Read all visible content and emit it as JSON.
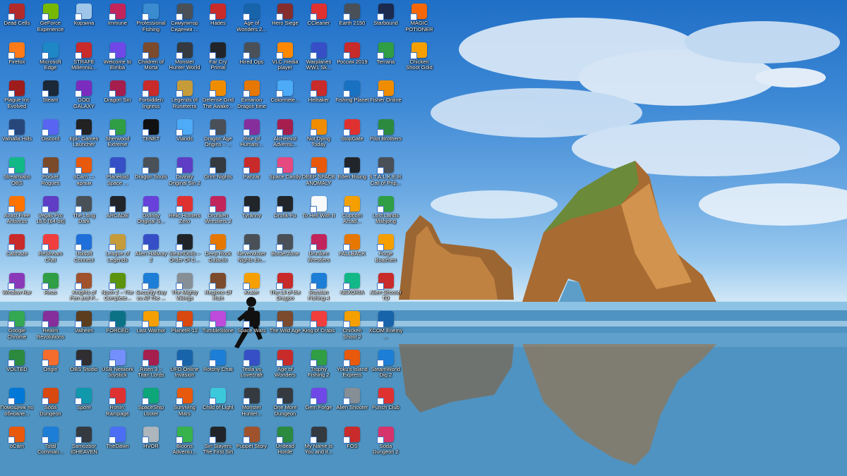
{
  "desktop": {
    "colors": {
      "sky_top": "#1f6fc7",
      "sky_mid": "#6aa8e2",
      "horizon": "#cfe6f6",
      "sea": "#3f84b4",
      "rock": "#b57a3c",
      "grass": "#6b8a3a"
    },
    "columns": [
      [
        {
          "label": "Dead Cells",
          "icon": "dead-cells-icon",
          "color": "#b32a2a"
        },
        {
          "label": "Firefox",
          "icon": "firefox-icon",
          "color": "#ff7a18"
        },
        {
          "label": "Plague Inc Evolved",
          "icon": "plague-inc-icon",
          "color": "#9e1c1c"
        },
        {
          "label": "Valhalla Hills",
          "icon": "valhalla-hills-icon",
          "color": "#27477a"
        },
        {
          "label": "Streamlabs OBS",
          "icon": "streamlabs-icon",
          "color": "#12b886"
        },
        {
          "label": "Avast Free Antivirus",
          "icon": "avast-icon",
          "color": "#ff7300"
        },
        {
          "label": "Catmaze",
          "icon": "catmaze-icon",
          "color": "#c92a2a"
        },
        {
          "label": "Window Rar",
          "icon": "winrar-icon",
          "color": "#8a3ab9"
        },
        {
          "label": "Google Chrome",
          "icon": "chrome-icon",
          "color": "#34a853"
        },
        {
          "label": "VOLTED",
          "icon": "volted-icon",
          "color": "#2b8a3e"
        },
        {
          "label": "Помощник по обновле...",
          "icon": "windows-update-icon",
          "color": "#0078d7"
        },
        {
          "label": "oCam",
          "icon": "ocam-icon",
          "color": "#e8590c"
        }
      ],
      [
        {
          "label": "GeForce Experience",
          "icon": "geforce-icon",
          "color": "#76b900"
        },
        {
          "label": "Microsoft Edge",
          "icon": "edge-icon",
          "color": "#1e88c7"
        },
        {
          "label": "Steam",
          "icon": "steam-icon",
          "color": "#1b2838"
        },
        {
          "label": "Discord",
          "icon": "discord-icon",
          "color": "#5865f2"
        },
        {
          "label": "Pocket Rogues",
          "icon": "pocket-rogues-icon",
          "color": "#7a4a2a"
        },
        {
          "label": "Vegas Pro 18.0 (64-bit)",
          "icon": "vegas-pro-icon",
          "color": "#5f3dc4"
        },
        {
          "label": "ReStream Chat",
          "icon": "restream-icon",
          "color": "#f03e3e"
        },
        {
          "label": "Reus",
          "icon": "reus-icon",
          "color": "#2f9e44"
        },
        {
          "label": "Realm Revolutions",
          "icon": "realm-revolutions-icon",
          "color": "#862e9c"
        },
        {
          "label": "Origin",
          "icon": "origin-icon",
          "color": "#f56c2d"
        },
        {
          "label": "Soda Dungeon",
          "icon": "soda-dungeon-icon",
          "color": "#d9480f"
        },
        {
          "label": "Total Comman...",
          "icon": "total-commander-icon",
          "color": "#1c7ed6"
        }
      ],
      [
        {
          "label": "Корзина",
          "icon": "recycle-bin-icon",
          "color": "#9fc5e8"
        },
        {
          "label": "STRAFE Millenniu...",
          "icon": "strafe-icon",
          "color": "#c92a2a"
        },
        {
          "label": "GOG GALAXY",
          "icon": "gog-galaxy-icon",
          "color": "#7b2cbf"
        },
        {
          "label": "Epic Games Launcher",
          "icon": "epic-games-icon",
          "color": "#222222"
        },
        {
          "label": "oCam — ярлык",
          "icon": "ocam-shortcut-icon",
          "color": "#e8590c"
        },
        {
          "label": "The Long Dark",
          "icon": "the-long-dark-icon",
          "color": "#495057"
        },
        {
          "label": "Ubisoft Connect",
          "icon": "ubisoft-icon",
          "color": "#1e6fd9"
        },
        {
          "label": "Knights of Pen and P...",
          "icon": "knights-pen-paper-icon",
          "color": "#a0522d"
        },
        {
          "label": "Valheim",
          "icon": "valheim-icon",
          "color": "#5c3d1e"
        },
        {
          "label": "OBS Studio",
          "icon": "obs-studio-icon",
          "color": "#302e31"
        },
        {
          "label": "Spore",
          "icon": "spore-icon",
          "color": "#1098ad"
        },
        {
          "label": "Samozbor IDHEAVEN",
          "icon": "samozbor-icon",
          "color": "#343a40"
        }
      ],
      [
        {
          "label": "Immune",
          "icon": "immune-icon",
          "color": "#c2255c"
        },
        {
          "label": "Welcome to Elmba",
          "icon": "welcome-elmba-icon",
          "color": "#7048e8"
        },
        {
          "label": "Dragon Sin",
          "icon": "dragon-sin-icon",
          "color": "#a61e4d"
        },
        {
          "label": "Sherwood Extreme",
          "icon": "sherwood-extreme-icon",
          "color": "#2f9e44"
        },
        {
          "label": "Planetoid Space ...",
          "icon": "planetoid-icon",
          "color": "#364fc7"
        },
        {
          "label": "ARCADE",
          "icon": "arcade-icon",
          "color": "#212529"
        },
        {
          "label": "League of Legends",
          "icon": "league-of-legends-icon",
          "color": "#c69b3a"
        },
        {
          "label": "Noch 2 – The Complete...",
          "icon": "noch-icon",
          "color": "#5c940d"
        },
        {
          "label": "FORCED",
          "icon": "forced-icon",
          "color": "#0b7285"
        },
        {
          "label": "USB Network Joystick",
          "icon": "usb-joystick-icon",
          "color": "#748ffc"
        },
        {
          "label": "Ronin: Rampage",
          "icon": "ronin-rampage-icon",
          "color": "#e03131"
        },
        {
          "label": "TheDawn",
          "icon": "thedawn-icon",
          "color": "#4c6ef5"
        }
      ],
      [
        {
          "label": "Professional Fishing",
          "icon": "professional-fishing-icon",
          "color": "#3b8bd0"
        },
        {
          "label": "Children of Morta",
          "icon": "children-of-morta-icon",
          "color": "#7c4a2d"
        },
        {
          "label": "Forbidden Ingress",
          "icon": "forbidden-ingress-icon",
          "color": "#c92a2a"
        },
        {
          "label": "TENET",
          "icon": "tenet-icon",
          "color": "#111111"
        },
        {
          "label": "Dragon Souls",
          "icon": "dragon-souls-icon",
          "color": "#495057"
        },
        {
          "label": "Divinity Original S...",
          "icon": "divinity-icon",
          "color": "#6741d9"
        },
        {
          "label": "Alien Hallway 2",
          "icon": "alien-hallway-icon",
          "color": "#364fc7"
        },
        {
          "label": "Security Guy vs All The ...",
          "icon": "security-guy-icon",
          "color": "#1c7ed6"
        },
        {
          "label": "Last Warrior",
          "icon": "last-warrior-icon",
          "color": "#f59f00"
        },
        {
          "label": "Risen 3 – Titan Lords",
          "icon": "risen-3-icon",
          "color": "#a61e4d"
        },
        {
          "label": "SpaceShip Looter",
          "icon": "spaceship-looter-icon",
          "color": "#0ca678"
        },
        {
          "label": "HVOR",
          "icon": "hvor-icon",
          "color": "#adb5bd"
        }
      ],
      [
        {
          "label": "Симулятор Сидения ...",
          "icon": "sitting-simulator-icon",
          "color": "#495057"
        },
        {
          "label": "Monster Hunter World",
          "icon": "monster-hunter-world-icon",
          "color": "#343a40"
        },
        {
          "label": "Legends of Runeterra",
          "icon": "legends-runeterra-icon",
          "color": "#c69b3a"
        },
        {
          "label": "Vlands",
          "icon": "vlands-icon",
          "color": "#4dabf7"
        },
        {
          "label": "Divinity Original Sin 2",
          "icon": "divinity-2-icon",
          "color": "#5f3dc4"
        },
        {
          "label": "Relic Hunters Zero",
          "icon": "relic-hunters-icon",
          "color": "#e03131"
        },
        {
          "label": "SteamDolls – Order Of C...",
          "icon": "steamdolls-icon",
          "color": "#212529"
        },
        {
          "label": "The Mighty Vikings",
          "icon": "mighty-vikings-icon",
          "color": "#868e96"
        },
        {
          "label": "PlanetR-12",
          "icon": "planetr12-icon",
          "color": "#d9480f"
        },
        {
          "label": "UFO Online Invasion",
          "icon": "ufo-online-icon",
          "color": "#1864ab"
        },
        {
          "label": "Surviving Mars",
          "icon": "surviving-mars-icon",
          "color": "#e8590c"
        },
        {
          "label": "Bloons Adventu...",
          "icon": "bloons-icon",
          "color": "#37b24d"
        }
      ],
      [
        {
          "label": "Hades",
          "icon": "hades-icon",
          "color": "#c92a2a"
        },
        {
          "label": "Far Cry Primal",
          "icon": "far-cry-primal-icon",
          "color": "#212529"
        },
        {
          "label": "Defense Grid The Awake...",
          "icon": "defense-grid-icon",
          "color": "#f08c00"
        },
        {
          "label": "Dragon Age Origins – ...",
          "icon": "dragon-age-icon",
          "color": "#495057"
        },
        {
          "label": "Grim Nights",
          "icon": "grim-nights-icon",
          "color": "#343a40"
        },
        {
          "label": "Drunken Wrestlers 2",
          "icon": "drunken-wrestlers-2-icon",
          "color": "#c2255c"
        },
        {
          "label": "Deep Rock Galactic",
          "icon": "deep-rock-icon",
          "color": "#e67700"
        },
        {
          "label": "Regions Of Ruin",
          "icon": "regions-of-ruin-icon",
          "color": "#7c4a2d"
        },
        {
          "label": "TumbleStone",
          "icon": "tumblestone-icon",
          "color": "#be4bdb"
        },
        {
          "label": "Rotony Chat",
          "icon": "rotony-chat-icon",
          "color": "#1c7ed6"
        },
        {
          "label": "Child of Light",
          "icon": "child-of-light-icon",
          "color": "#3bc9db"
        },
        {
          "label": "Sin Slayers The First Sin",
          "icon": "sin-slayers-icon",
          "color": "#212529"
        }
      ],
      [
        {
          "label": "Age of Wonders 2...",
          "icon": "age-of-wonders-2-icon",
          "color": "#1864ab"
        },
        {
          "label": "Hired Ops",
          "icon": "hired-ops-icon",
          "color": "#495057"
        },
        {
          "label": "Eimarion Dragon time",
          "icon": "eimarion-icon",
          "color": "#e67700"
        },
        {
          "label": "Rise of Humani...",
          "icon": "rise-of-humanity-icon",
          "color": "#862e9c"
        },
        {
          "label": "Panzar",
          "icon": "panzar-icon",
          "color": "#c92a2a"
        },
        {
          "label": "Tyranny",
          "icon": "tyranny-icon",
          "color": "#212529"
        },
        {
          "label": "Neverwinter Nights En...",
          "icon": "neverwinter-icon",
          "color": "#495057"
        },
        {
          "label": "Krater",
          "icon": "krater-icon",
          "color": "#f59f00"
        },
        {
          "label": "Space Wars",
          "icon": "space-wars-icon",
          "color": "#111111"
        },
        {
          "label": "Tesla vs Lovecraft",
          "icon": "tesla-lovecraft-icon",
          "color": "#364fc7"
        },
        {
          "label": "Monster Hunter...",
          "icon": "monster-hunter-icon",
          "color": "#343a40"
        },
        {
          "label": "Puppet Story",
          "icon": "puppet-story-icon",
          "color": "#a0522d"
        }
      ],
      [
        {
          "label": "Hero Siege",
          "icon": "hero-siege-icon",
          "color": "#862e2e"
        },
        {
          "label": "VLC media player",
          "icon": "vlc-icon",
          "color": "#ff8800"
        },
        {
          "label": "Colormele...",
          "icon": "colormele-icon",
          "color": "#4dabf7"
        },
        {
          "label": "Alchemist Adventu...",
          "icon": "alchemist-icon",
          "color": "#a61e4d"
        },
        {
          "label": "Space Candy",
          "icon": "space-candy-icon",
          "color": "#e64980"
        },
        {
          "label": "Drunk-Fu",
          "icon": "drunk-fu-icon",
          "color": "#212529"
        },
        {
          "label": "BorderZone",
          "icon": "borderzone-icon",
          "color": "#495057"
        },
        {
          "label": "The Lil of the Dragon",
          "icon": "lil-dragon-icon",
          "color": "#c92a2a"
        },
        {
          "label": "The Wild Age",
          "icon": "wild-age-icon",
          "color": "#7c4a2d"
        },
        {
          "label": "Age of Wonders",
          "icon": "age-of-wonders-icon",
          "color": "#c92a2a"
        },
        {
          "label": "One More Dungeon",
          "icon": "one-more-dungeon-icon",
          "color": "#343a40"
        },
        {
          "label": "Undead Horde",
          "icon": "undead-horde-icon",
          "color": "#2b8a3e"
        }
      ],
      [
        {
          "label": "CCleaner",
          "icon": "ccleaner-icon",
          "color": "#e03131"
        },
        {
          "label": "Warplanes WW1 Sk...",
          "icon": "warplanes-icon",
          "color": "#364fc7"
        },
        {
          "label": "Helltaker",
          "icon": "helltaker-icon",
          "color": "#c92a2a"
        },
        {
          "label": "Not Dying Today",
          "icon": "not-dying-today-icon",
          "color": "#f08c00"
        },
        {
          "label": "DEEP SPACE ANOMALY",
          "icon": "deep-space-anomaly-icon",
          "color": "#e8590c"
        },
        {
          "label": "To Hell With It",
          "icon": "to-hell-with-it-icon",
          "color": "#f8f9fa"
        },
        {
          "label": "Drunken Wrestlers",
          "icon": "drunken-wrestlers-icon",
          "color": "#c2255c"
        },
        {
          "label": "Russian Fishing 4",
          "icon": "russian-fishing-icon",
          "color": "#1c7ed6"
        },
        {
          "label": "King of Crabs",
          "icon": "king-of-crabs-icon",
          "color": "#f03e3e"
        },
        {
          "label": "Trophy Fishing 2",
          "icon": "trophy-fishing-icon",
          "color": "#2f9e44"
        },
        {
          "label": "Gem Forge",
          "icon": "gem-forge-icon",
          "color": "#7048e8"
        },
        {
          "label": "My Name is You and it...",
          "icon": "my-name-is-you-icon",
          "color": "#343a40"
        }
      ],
      [
        {
          "label": "Earth 2150",
          "icon": "earth-2150-icon",
          "color": "#495057"
        },
        {
          "label": "Россия 2019",
          "icon": "russia-2019-icon",
          "color": "#c92a2a"
        },
        {
          "label": "Fishing Planet",
          "icon": "fishing-planet-icon",
          "color": "#1971c2"
        },
        {
          "label": "StopGate",
          "icon": "stopgate-icon",
          "color": "#e03131"
        },
        {
          "label": "Eden Rising",
          "icon": "eden-rising-icon",
          "color": "#212529"
        },
        {
          "label": "Cupcom Arcad...",
          "icon": "cupcom-arcade-icon",
          "color": "#f59f00"
        },
        {
          "label": "FALLBACK",
          "icon": "fallback-icon",
          "color": "#e67700"
        },
        {
          "label": "NEXORIA",
          "icon": "nexoria-icon",
          "color": "#12b886"
        },
        {
          "label": "Chicken Shoot 2",
          "icon": "chicken-shoot-2-icon",
          "color": "#f59f00"
        },
        {
          "label": "Yoku's Island Express",
          "icon": "yokus-island-icon",
          "color": "#e8590c"
        },
        {
          "label": "Alien Shooter",
          "icon": "alien-shooter-icon",
          "color": "#868e96"
        },
        {
          "label": "FOS",
          "icon": "fos-icon",
          "color": "#c92a2a"
        }
      ],
      [
        {
          "label": "Starbound",
          "icon": "starbound-icon",
          "color": "#1b2a4e"
        },
        {
          "label": "Terraria",
          "icon": "terraria-icon",
          "color": "#2f9e44"
        },
        {
          "label": "Fisher Online",
          "icon": "fisher-online-icon",
          "color": "#f08c00"
        },
        {
          "label": "Pilot Brothers",
          "icon": "pilot-brothers-icon",
          "color": "#2b8a3e"
        },
        {
          "label": "S.T.A.L.K.E.R. Call of Prip...",
          "icon": "stalker-icon",
          "color": "#495057"
        },
        {
          "label": "Lost Lands Mahjong",
          "icon": "lost-lands-mahjong-icon",
          "color": "#2f9e44"
        },
        {
          "label": "Forge Boatmen",
          "icon": "forge-boatmen-icon",
          "color": "#f59f00"
        },
        {
          "label": "Alien Shooter TD",
          "icon": "alien-shooter-td-icon",
          "color": "#c92a2a"
        },
        {
          "label": "XCOM Enemy ...",
          "icon": "xcom-icon",
          "color": "#1864ab"
        },
        {
          "label": "SteamWorld Dig 2",
          "icon": "steamworld-dig-2-icon",
          "color": "#1c7ed6"
        },
        {
          "label": "Punch Club",
          "icon": "punch-club-icon",
          "color": "#e03131"
        },
        {
          "label": "Soda Dungeon 2",
          "icon": "soda-dungeon-2-icon",
          "color": "#d6336c"
        }
      ],
      [
        {
          "label": "MAGIC POTIONER B...",
          "icon": "magic-potioner-icon",
          "color": "#f76707"
        },
        {
          "label": "Chicken Shoot Gold",
          "icon": "chicken-shoot-gold-icon",
          "color": "#f59f00"
        }
      ]
    ]
  }
}
